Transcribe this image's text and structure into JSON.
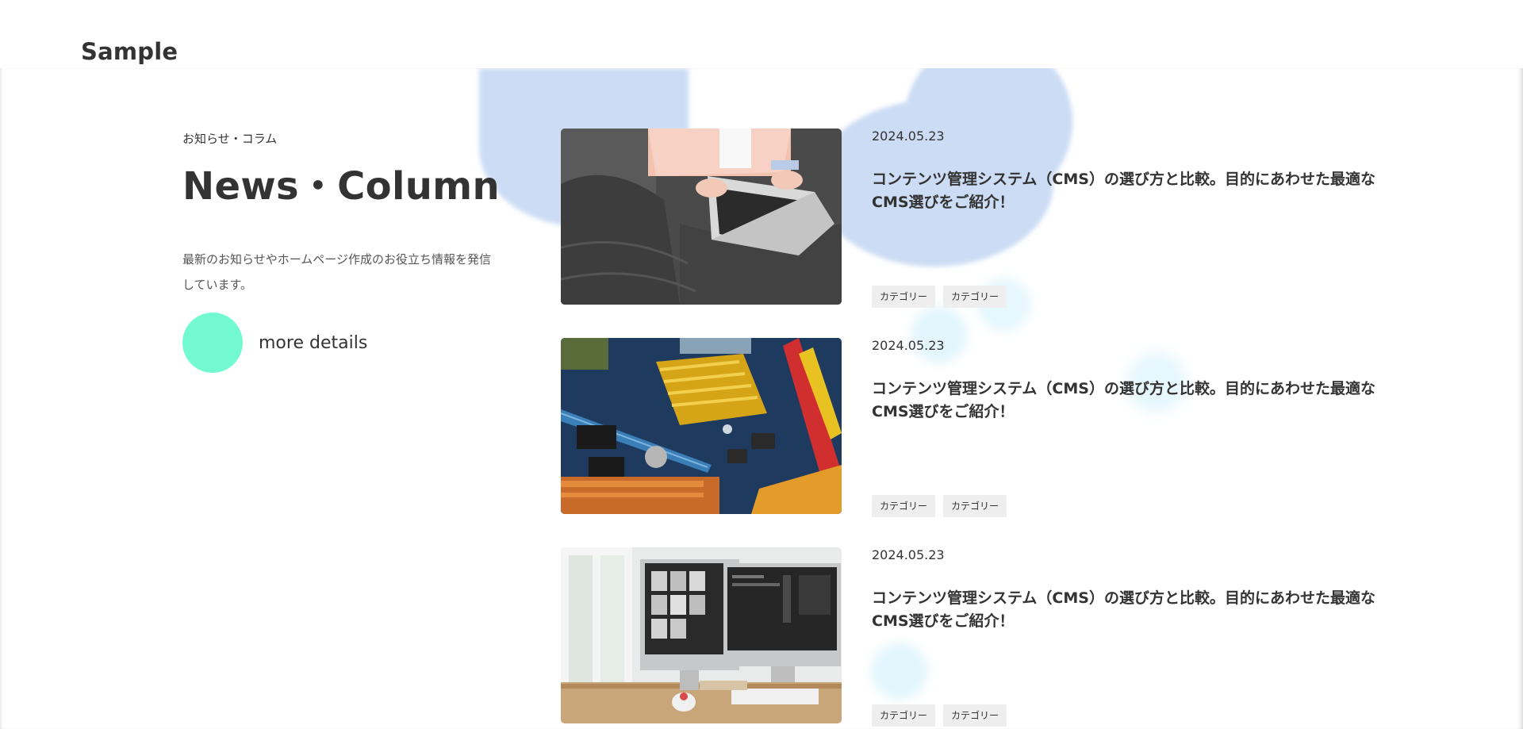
{
  "header": {
    "logo": "Sample"
  },
  "intro": {
    "subtitle": "お知らせ・コラム",
    "title": "News・Column",
    "description": "最新のお知らせやホームページ作成のお役立ち情報を発信しています。",
    "more_label": "more details"
  },
  "colors": {
    "accent": "#73fad2",
    "bubble": "#cbdcf4",
    "text": "#333333"
  },
  "posts": [
    {
      "date": "2024.05.23",
      "title": "コンテンツ管理システム（CMS）の選び方と比較。目的にあわせた最適なCMS選びをご紹介！",
      "image": "laptop-photo",
      "tags": [
        "カテゴリー",
        "カテゴリー"
      ]
    },
    {
      "date": "2024.05.23",
      "title": "コンテンツ管理システム（CMS）の選び方と比較。目的にあわせた最適なCMS選びをご紹介！",
      "image": "circuit-board-photo",
      "tags": [
        "カテゴリー",
        "カテゴリー"
      ]
    },
    {
      "date": "2024.05.23",
      "title": "コンテンツ管理システム（CMS）の選び方と比較。目的にあわせた最適なCMS選びをご紹介！",
      "image": "imac-desk-photo",
      "tags": [
        "カテゴリー",
        "カテゴリー"
      ]
    }
  ]
}
